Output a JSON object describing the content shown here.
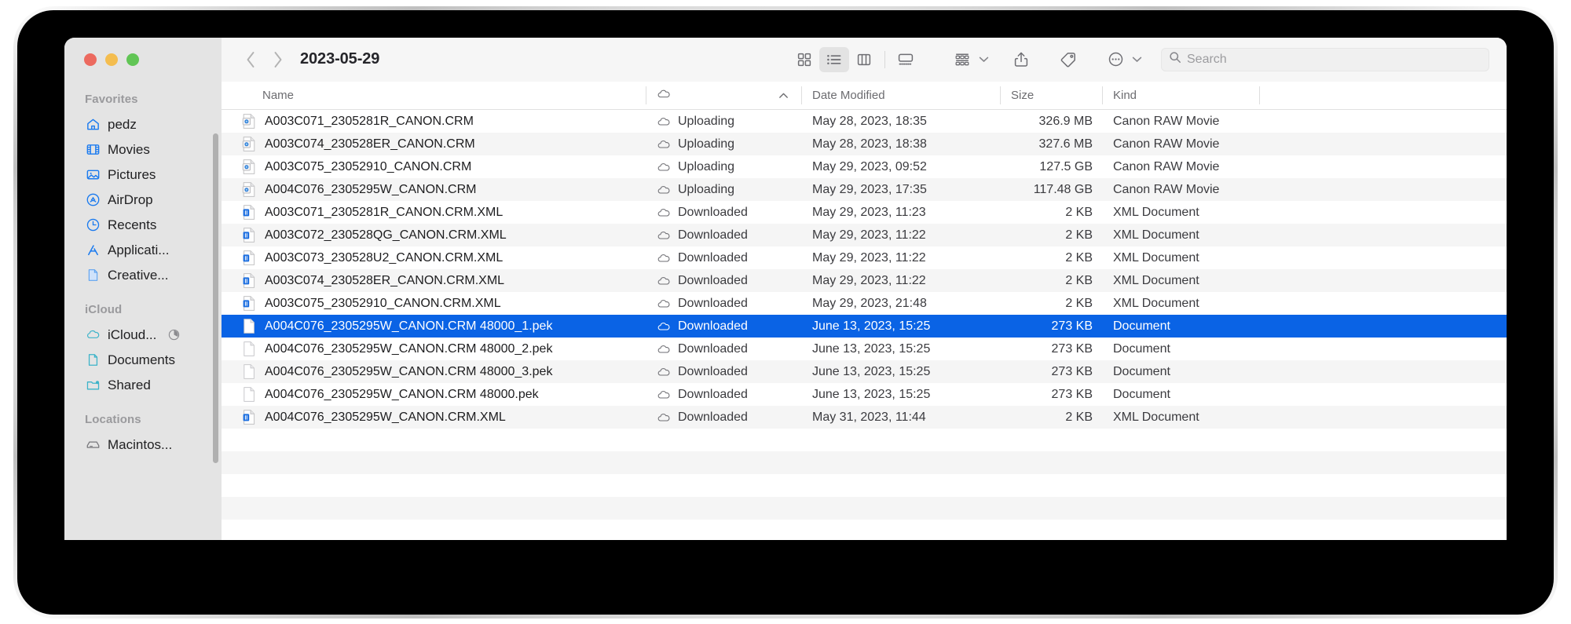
{
  "window": {
    "title": "2023-05-29",
    "traffic_lights": [
      {
        "name": "close",
        "color": "#ec6a5f"
      },
      {
        "name": "minimize",
        "color": "#f4bd4f"
      },
      {
        "name": "maximize",
        "color": "#61c555"
      }
    ]
  },
  "toolbar": {
    "back_label": "Back",
    "forward_label": "Forward",
    "view_buttons": [
      {
        "name": "icon-view",
        "label": "Icon View",
        "active": false
      },
      {
        "name": "list-view",
        "label": "List View",
        "active": true
      },
      {
        "name": "column-view",
        "label": "Column View",
        "active": false
      },
      {
        "name": "gallery-view",
        "label": "Gallery View",
        "active": false
      }
    ],
    "group_label": "Group",
    "share_label": "Share",
    "tags_label": "Tags",
    "more_label": "More"
  },
  "search": {
    "placeholder": "Search",
    "value": ""
  },
  "sidebar": {
    "sections": [
      {
        "header": "Favorites",
        "items": [
          {
            "label": "pedz",
            "icon": "home-icon"
          },
          {
            "label": "Movies",
            "icon": "movies-icon"
          },
          {
            "label": "Pictures",
            "icon": "pictures-icon"
          },
          {
            "label": "AirDrop",
            "icon": "airdrop-icon"
          },
          {
            "label": "Recents",
            "icon": "recents-clock-icon"
          },
          {
            "label": "Applicati...",
            "icon": "applications-icon"
          },
          {
            "label": "Creative...",
            "icon": "document-icon"
          }
        ]
      },
      {
        "header": "iCloud",
        "items": [
          {
            "label": "iCloud...",
            "icon": "icloud-icon",
            "trailing": "sync-progress-icon"
          },
          {
            "label": "Documents",
            "icon": "documents-icon"
          },
          {
            "label": "Shared",
            "icon": "shared-folder-icon"
          }
        ]
      },
      {
        "header": "Locations",
        "items": [
          {
            "label": "Macintos...",
            "icon": "hard-drive-icon"
          }
        ]
      }
    ]
  },
  "file_table": {
    "columns": [
      {
        "key": "name",
        "label": "Name"
      },
      {
        "key": "status",
        "label": "",
        "icon": "cloud-icon",
        "sorted": true,
        "sort_direction": "ascending"
      },
      {
        "key": "date",
        "label": "Date Modified"
      },
      {
        "key": "size",
        "label": "Size"
      },
      {
        "key": "kind",
        "label": "Kind"
      }
    ],
    "selected_index": 9,
    "rows": [
      {
        "name": "A003C071_2305281R_CANON.CRM",
        "icon": "raw-movie-icon",
        "status": "Uploading",
        "date": "May 28, 2023, 18:35",
        "size": "326.9 MB",
        "kind": "Canon RAW Movie"
      },
      {
        "name": "A003C074_230528ER_CANON.CRM",
        "icon": "raw-movie-icon",
        "status": "Uploading",
        "date": "May 28, 2023, 18:38",
        "size": "327.6 MB",
        "kind": "Canon RAW Movie"
      },
      {
        "name": "A003C075_23052910_CANON.CRM",
        "icon": "raw-movie-icon",
        "status": "Uploading",
        "date": "May 29, 2023, 09:52",
        "size": "127.5 GB",
        "kind": "Canon RAW Movie"
      },
      {
        "name": "A004C076_2305295W_CANON.CRM",
        "icon": "raw-movie-icon",
        "status": "Uploading",
        "date": "May 29, 2023, 17:35",
        "size": "117.48 GB",
        "kind": "Canon RAW Movie"
      },
      {
        "name": "A003C071_2305281R_CANON.CRM.XML",
        "icon": "xml-icon",
        "status": "Downloaded",
        "date": "May 29, 2023, 11:23",
        "size": "2 KB",
        "kind": "XML Document"
      },
      {
        "name": "A003C072_230528QG_CANON.CRM.XML",
        "icon": "xml-icon",
        "status": "Downloaded",
        "date": "May 29, 2023, 11:22",
        "size": "2 KB",
        "kind": "XML Document"
      },
      {
        "name": "A003C073_230528U2_CANON.CRM.XML",
        "icon": "xml-icon",
        "status": "Downloaded",
        "date": "May 29, 2023, 11:22",
        "size": "2 KB",
        "kind": "XML Document"
      },
      {
        "name": "A003C074_230528ER_CANON.CRM.XML",
        "icon": "xml-icon",
        "status": "Downloaded",
        "date": "May 29, 2023, 11:22",
        "size": "2 KB",
        "kind": "XML Document"
      },
      {
        "name": "A003C075_23052910_CANON.CRM.XML",
        "icon": "xml-icon",
        "status": "Downloaded",
        "date": "May 29, 2023, 21:48",
        "size": "2 KB",
        "kind": "XML Document"
      },
      {
        "name": "A004C076_2305295W_CANON.CRM 48000_1.pek",
        "icon": "blank-doc-icon",
        "status": "Downloaded",
        "date": "June 13, 2023, 15:25",
        "size": "273 KB",
        "kind": "Document"
      },
      {
        "name": "A004C076_2305295W_CANON.CRM 48000_2.pek",
        "icon": "blank-doc-icon",
        "status": "Downloaded",
        "date": "June 13, 2023, 15:25",
        "size": "273 KB",
        "kind": "Document"
      },
      {
        "name": "A004C076_2305295W_CANON.CRM 48000_3.pek",
        "icon": "blank-doc-icon",
        "status": "Downloaded",
        "date": "June 13, 2023, 15:25",
        "size": "273 KB",
        "kind": "Document"
      },
      {
        "name": "A004C076_2305295W_CANON.CRM 48000.pek",
        "icon": "blank-doc-icon",
        "status": "Downloaded",
        "date": "June 13, 2023, 15:25",
        "size": "273 KB",
        "kind": "Document"
      },
      {
        "name": "A004C076_2305295W_CANON.CRM.XML",
        "icon": "xml-icon",
        "status": "Downloaded",
        "date": "May 31, 2023, 11:44",
        "size": "2 KB",
        "kind": "XML Document"
      }
    ]
  },
  "colors": {
    "selection_blue": "#0a63e5",
    "sidebar_bg": "#e4e4e4",
    "toolbar_bg": "#f6f6f6",
    "alt_row": "#f5f5f5",
    "accent_icon_blue": "#1a7aef",
    "icloud_teal": "#3cb3c9"
  }
}
